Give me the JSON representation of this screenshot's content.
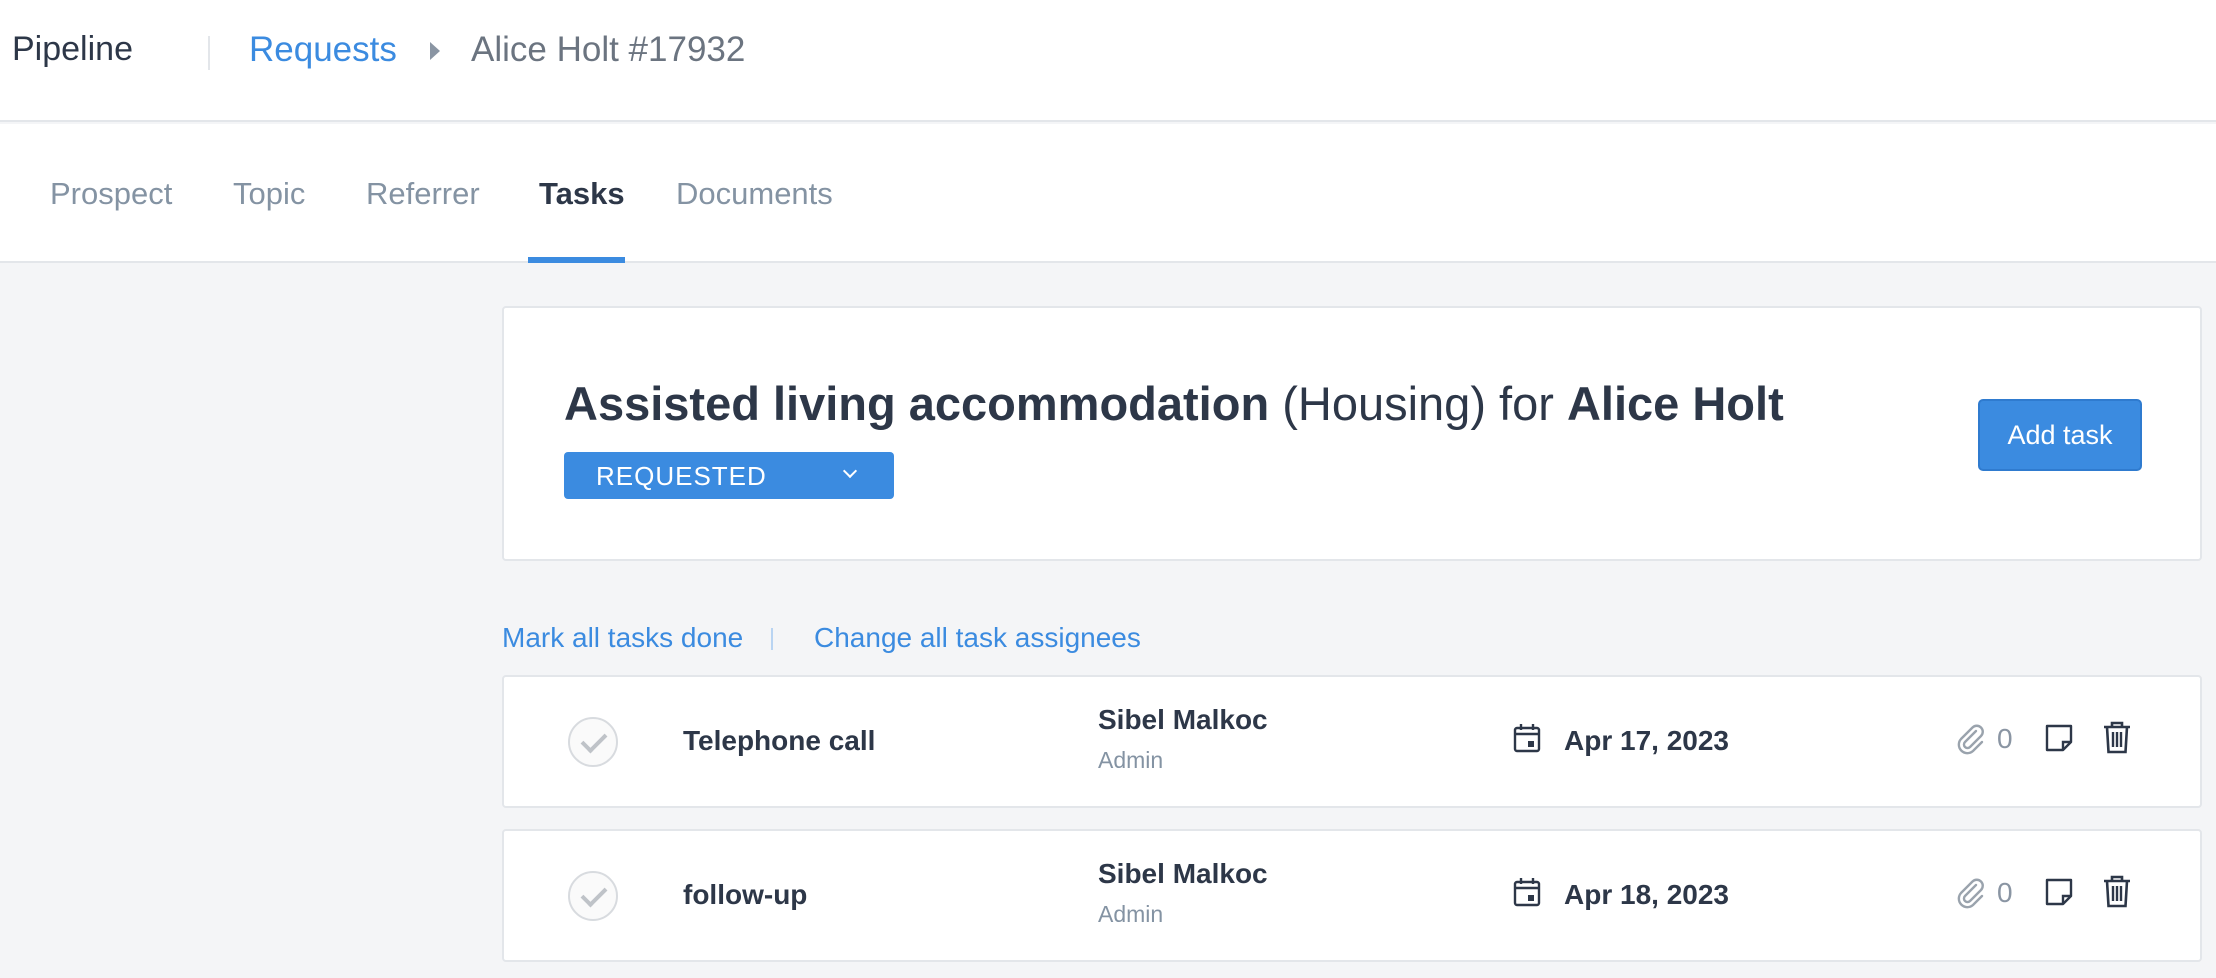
{
  "topbar": {
    "app_title": "Pipeline",
    "breadcrumb": {
      "section": "Requests",
      "current": "Alice Holt #17932"
    }
  },
  "tabs": [
    {
      "label": "Prospect",
      "active": false
    },
    {
      "label": "Topic",
      "active": false
    },
    {
      "label": "Referrer",
      "active": false
    },
    {
      "label": "Tasks",
      "active": true
    },
    {
      "label": "Documents",
      "active": false
    }
  ],
  "request": {
    "service": "Assisted living accommodation",
    "category": "(Housing)",
    "for_word": "for",
    "client": "Alice Holt",
    "status": "REQUESTED",
    "add_task_label": "Add task"
  },
  "bulk_actions": {
    "mark_done": "Mark all tasks done",
    "change_assignees": "Change all task assignees"
  },
  "tasks": [
    {
      "name": "Telephone call",
      "assignee": "Sibel Malkoc",
      "role": "Admin",
      "due": "Apr 17, 2023",
      "attachments": "0"
    },
    {
      "name": "follow-up",
      "assignee": "Sibel Malkoc",
      "role": "Admin",
      "due": "Apr 18, 2023",
      "attachments": "0"
    }
  ],
  "colors": {
    "accent": "#3b8be0",
    "text": "#2d3748",
    "muted": "#8493a3",
    "background": "#f4f5f7"
  }
}
